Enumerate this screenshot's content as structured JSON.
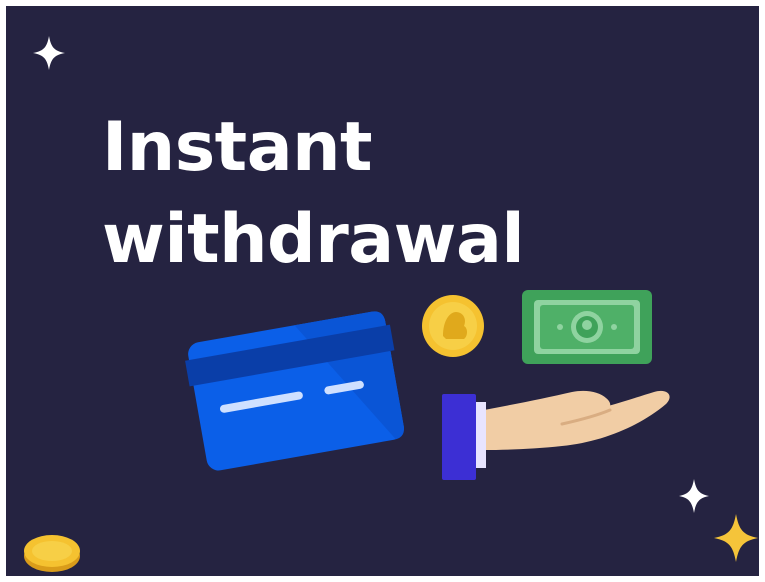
{
  "banner": {
    "headline_line1": "Instant",
    "headline_line2": "withdrawal"
  },
  "colors": {
    "background": "#252341",
    "text": "#ffffff",
    "card": "#0b5fe8",
    "card_dark": "#0a4cc0",
    "coin": "#f5c230",
    "banknote": "#3fa25a",
    "sleeve": "#3c2fd4",
    "hand": "#f1cda5",
    "sparkle_gold": "#f5c43a"
  },
  "icons": [
    "sparkle-icon",
    "credit-card-icon",
    "coin-icon",
    "banknote-icon",
    "hand-icon"
  ]
}
